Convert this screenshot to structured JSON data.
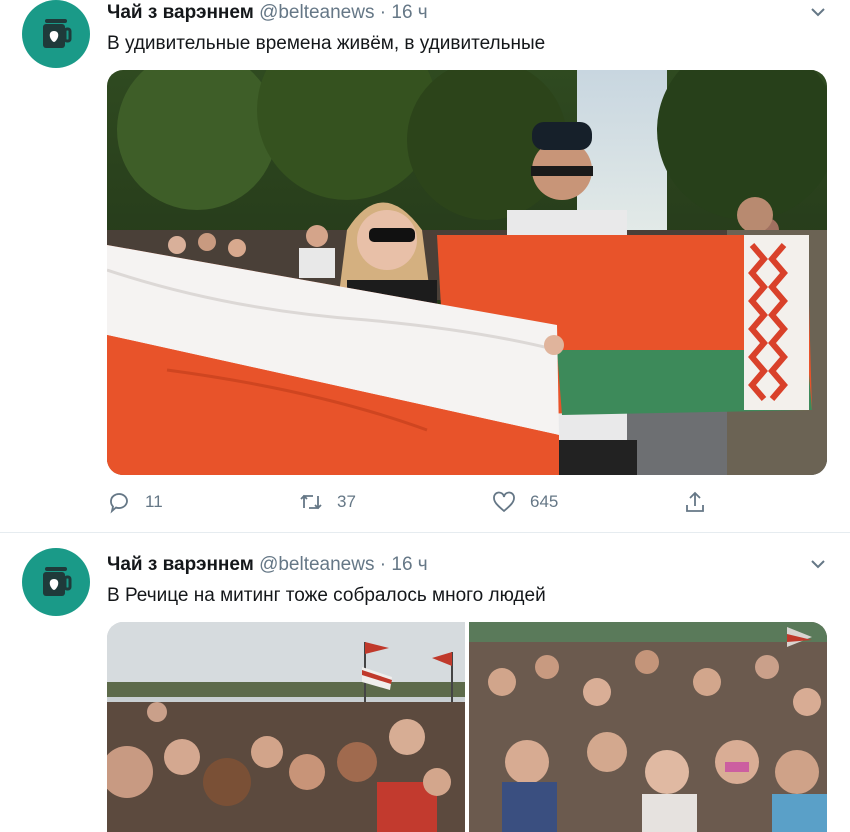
{
  "tweets": [
    {
      "author_name": "Чай з варэннем",
      "handle": "@belteanews",
      "separator": "·",
      "time": "16 ч",
      "text": "В удивительные времена живём, в удивительные",
      "replies": "11",
      "retweets": "37",
      "likes": "645"
    },
    {
      "author_name": "Чай з варэннем",
      "handle": "@belteanews",
      "separator": "·",
      "time": "16 ч",
      "text": "В Речице на митинг тоже собралось много людей"
    }
  ],
  "colors": {
    "avatar_bg": "#1a9a88",
    "flag_red": "#e8532a",
    "flag_green": "#3d8a5a",
    "muted_text": "#657786"
  },
  "icons": [
    "mug-logo-icon",
    "chevron-down-icon",
    "reply-icon",
    "retweet-icon",
    "like-icon",
    "share-icon"
  ]
}
